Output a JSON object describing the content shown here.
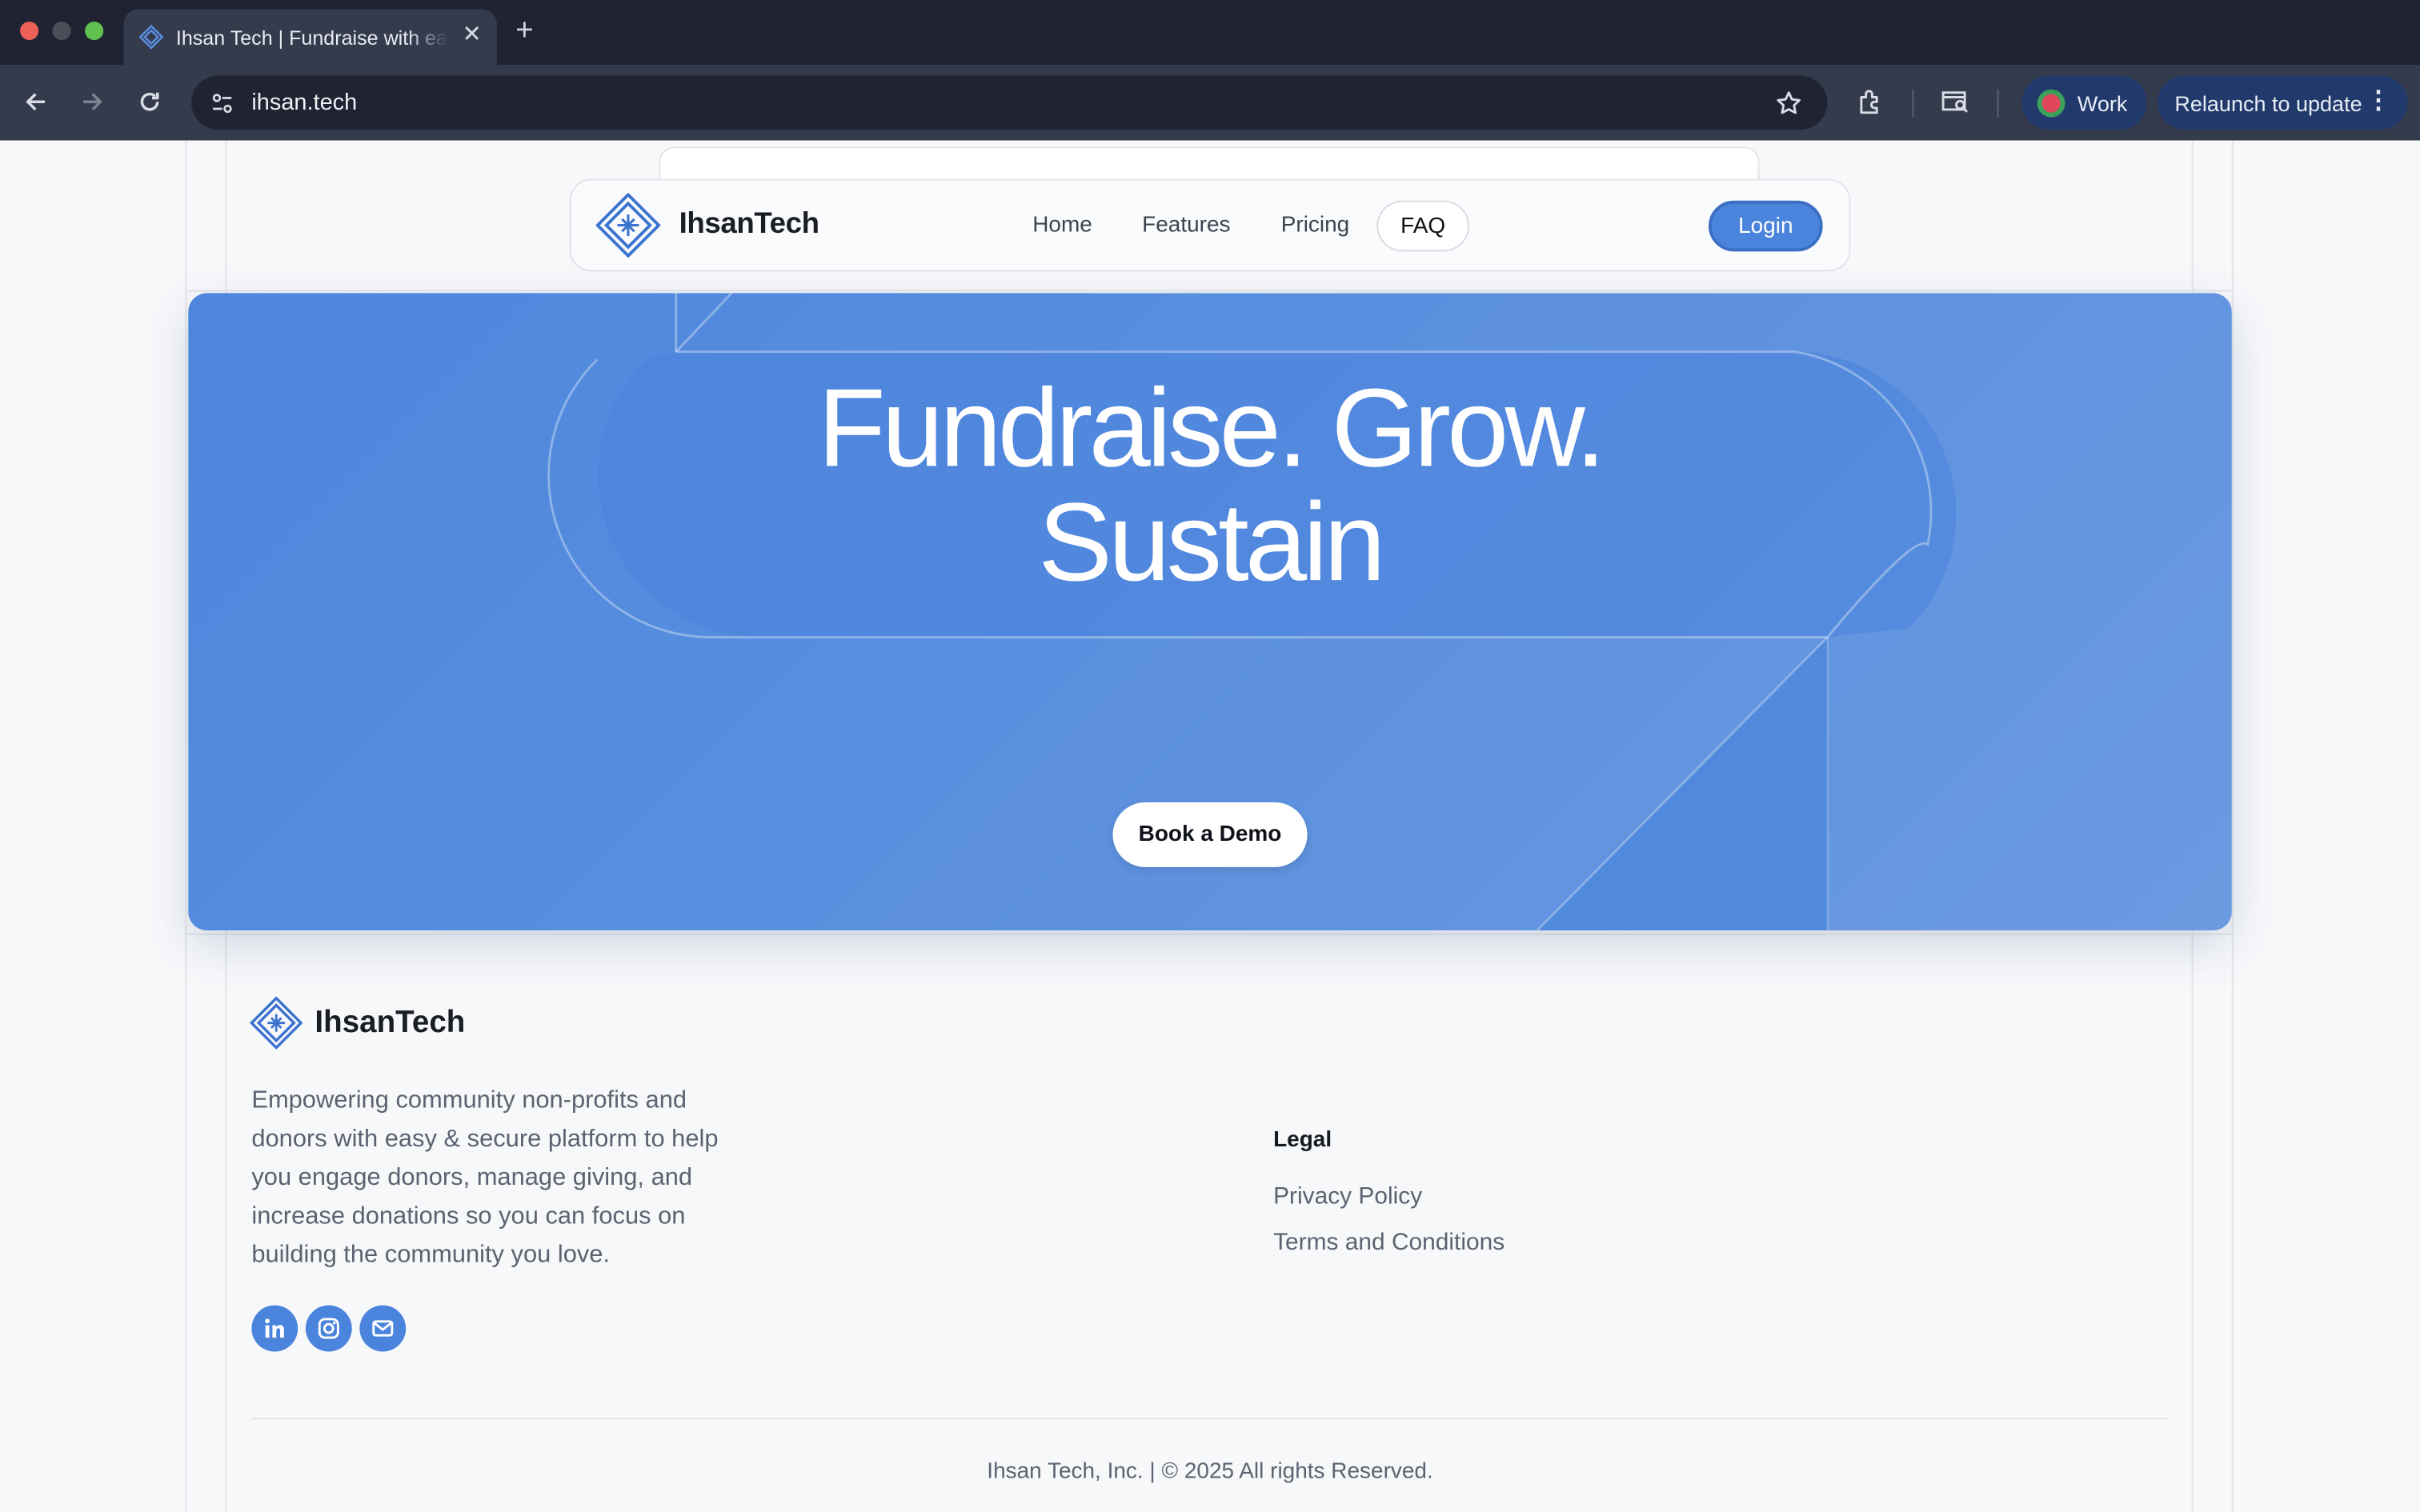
{
  "browser": {
    "tab_title": "Ihsan Tech | Fundraise with ease",
    "url": "ihsan.tech",
    "profile_label": "Work",
    "relaunch_label": "Relaunch to update"
  },
  "navbar": {
    "brand": "IhsanTech",
    "links": [
      "Home",
      "Features",
      "Pricing",
      "FAQ"
    ],
    "login_label": "Login"
  },
  "hero": {
    "title_line1": "Fundraise. Grow.",
    "title_line2": "Sustain",
    "cta_label": "Book a Demo",
    "accent_color": "#4a84dc"
  },
  "footer": {
    "brand": "IhsanTech",
    "description": "Empowering community non-profits and donors with easy & secure platform to help you engage donors, manage giving, and increase donations so you can focus on building the community you love.",
    "social_icons": [
      "linkedin-icon",
      "instagram-icon",
      "email-icon"
    ],
    "legal": {
      "heading": "Legal",
      "links": [
        "Privacy Policy",
        "Terms and Conditions"
      ]
    },
    "copyright": "Ihsan Tech, Inc. | © 2025 All rights Reserved."
  }
}
